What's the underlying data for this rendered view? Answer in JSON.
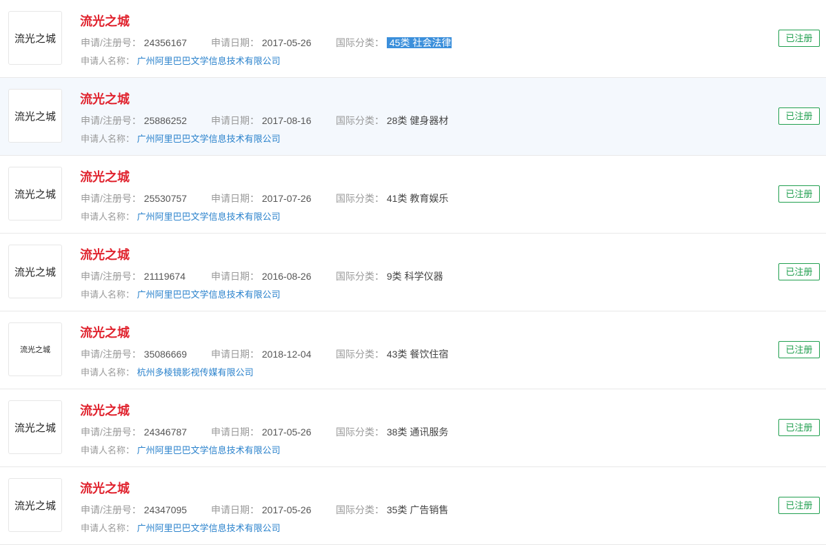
{
  "labels": {
    "reg_no": "申请/注册号：",
    "app_date": "申请日期：",
    "intl_class": "国际分类：",
    "applicant": "申请人名称："
  },
  "colors": {
    "title": "#e0232e",
    "applicant_link": "#2a82cc",
    "status_green": "#1e9e4d",
    "selection": "#3b8fdb",
    "hover_row": "#f4f8fd"
  },
  "records": [
    {
      "logo_text": "流光之城",
      "name": "流光之城",
      "reg_no": "24356167",
      "app_date": "2017-05-26",
      "intl_class": "45类 社会法律",
      "applicant": "广州阿里巴巴文学信息技术有限公司",
      "status": "已注册"
    },
    {
      "logo_text": "流光之城",
      "name": "流光之城",
      "reg_no": "25886252",
      "app_date": "2017-08-16",
      "intl_class": "28类 健身器材",
      "applicant": "广州阿里巴巴文学信息技术有限公司",
      "status": "已注册"
    },
    {
      "logo_text": "流光之城",
      "name": "流光之城",
      "reg_no": "25530757",
      "app_date": "2017-07-26",
      "intl_class": "41类 教育娱乐",
      "applicant": "广州阿里巴巴文学信息技术有限公司",
      "status": "已注册"
    },
    {
      "logo_text": "流光之城",
      "name": "流光之城",
      "reg_no": "21119674",
      "app_date": "2016-08-26",
      "intl_class": "9类 科学仪器",
      "applicant": "广州阿里巴巴文学信息技术有限公司",
      "status": "已注册"
    },
    {
      "logo_text": "流光之城",
      "name": "流光之城",
      "reg_no": "35086669",
      "app_date": "2018-12-04",
      "intl_class": "43类 餐饮住宿",
      "applicant": "杭州多棱镜影视传媒有限公司",
      "status": "已注册"
    },
    {
      "logo_text": "流光之城",
      "name": "流光之城",
      "reg_no": "24346787",
      "app_date": "2017-05-26",
      "intl_class": "38类 通讯服务",
      "applicant": "广州阿里巴巴文学信息技术有限公司",
      "status": "已注册"
    },
    {
      "logo_text": "流光之城",
      "name": "流光之城",
      "reg_no": "24347095",
      "app_date": "2017-05-26",
      "intl_class": "35类 广告销售",
      "applicant": "广州阿里巴巴文学信息技术有限公司",
      "status": "已注册"
    }
  ]
}
